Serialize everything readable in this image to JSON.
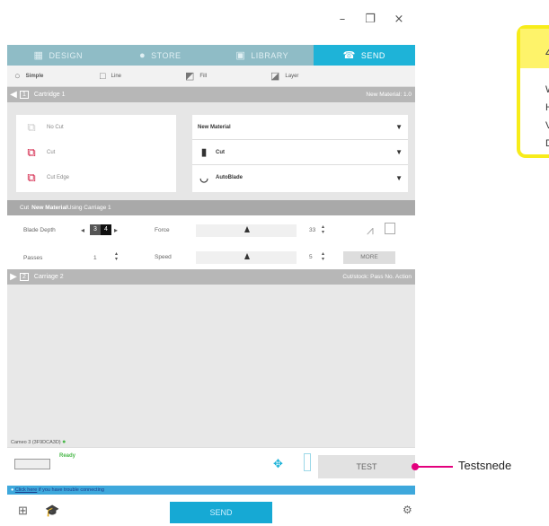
{
  "window": {
    "minimize": "–",
    "restore": "❐",
    "close": "×"
  },
  "nav": {
    "tabs": [
      {
        "label": "DESIGN",
        "icon": "design-icon"
      },
      {
        "label": "STORE",
        "icon": "store-icon"
      },
      {
        "label": "LIBRARY",
        "icon": "library-icon"
      },
      {
        "label": "SEND",
        "icon": "send-icon",
        "active": true
      }
    ]
  },
  "modes": [
    "Simple",
    "Line",
    "Fill",
    "Layer"
  ],
  "cartridge1": {
    "num": "1",
    "label": "Cartridge 1",
    "right": "New Material: 1.0"
  },
  "cutoptions": [
    "No Cut",
    "Cut",
    "Cut Edge"
  ],
  "material": {
    "rows": [
      "New Material",
      "Cut",
      "AutoBlade"
    ]
  },
  "cutlabel": {
    "prefix": "Cut ",
    "material": "New Material",
    "suffix": " Using Carriage 1"
  },
  "settings": {
    "blade_depth_label": "Blade Depth",
    "blade_values": [
      "3",
      "4"
    ],
    "force_label": "Force",
    "force_value": "33",
    "passes_label": "Passes",
    "passes_value": "1",
    "speed_label": "Speed",
    "speed_value": "5",
    "more": "MORE"
  },
  "cartridge2": {
    "num": "2",
    "label": "Carriage 2",
    "right": "Cut/stock: Pass No. Action"
  },
  "status": {
    "device": "Cameo 3 (3F9DCA3D)",
    "ready": "Ready"
  },
  "test_button": "TEST",
  "help": {
    "link": "Click here",
    "text": " if you have trouble connecting"
  },
  "send_button": "SEND",
  "callout": {
    "heading": "4",
    "lines": [
      "W",
      "H",
      "V",
      "D"
    ]
  },
  "annotation": {
    "label": "Testsnede",
    "color": "#e3007d"
  },
  "colors": {
    "accent": "#1eb3d8",
    "callout": "#f7ec1a",
    "ready": "#4ab84a"
  }
}
